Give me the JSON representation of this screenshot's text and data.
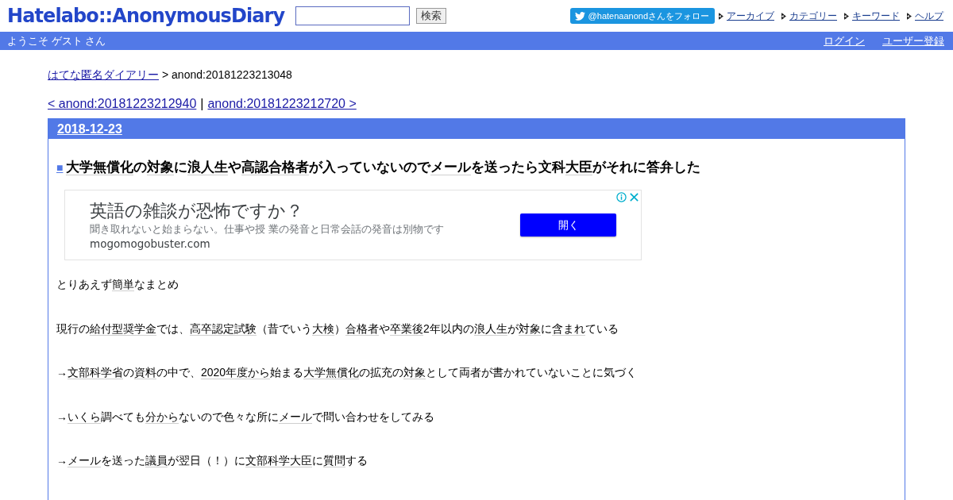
{
  "header": {
    "logo": "Hatelabo::AnonymousDiary",
    "search_button": "検索",
    "follow_button": "@hatenaanondさんをフォロー",
    "nav_links": [
      "アーカイブ",
      "カテゴリー",
      "キーワード",
      "ヘルプ"
    ]
  },
  "user_bar": {
    "greeting": "ようこそ ゲスト さん",
    "links": [
      "ログイン",
      "ユーザー登録"
    ]
  },
  "breadcrumb": {
    "home": "はてな匿名ダイアリー",
    "current": "> anond:20181223213048"
  },
  "pager": {
    "prev": "< anond:20181223212940",
    "separator": "|",
    "next": "anond:20181223212720 >"
  },
  "day": {
    "date": "2018-12-23",
    "entry": {
      "marker": "■",
      "title": [
        {
          "text": "大学無償化",
          "kind": "keyword"
        },
        {
          "text": "の",
          "kind": "text"
        },
        {
          "text": "対象",
          "kind": "keyword"
        },
        {
          "text": "に",
          "kind": "text"
        },
        {
          "text": "浪人生",
          "kind": "keyword"
        },
        {
          "text": "や",
          "kind": "text"
        },
        {
          "text": "高認合格者",
          "kind": "keyword"
        },
        {
          "text": "が入っていないので",
          "kind": "text"
        },
        {
          "text": "メール",
          "kind": "keyword"
        },
        {
          "text": "を送ったら文科",
          "kind": "text"
        },
        {
          "text": "大臣",
          "kind": "keyword"
        },
        {
          "text": "がそれに答弁した",
          "kind": "text"
        }
      ],
      "ad": {
        "headline": "英語の雑談が恐怖ですか？",
        "description": "聞き取れないと始まらない。仕事や授 業の発音と日常会話の発音は別物です",
        "domain": "mogomogobuster.com",
        "button": "開く"
      },
      "paragraphs": [
        [
          {
            "text": "とりあえず",
            "kind": "text"
          },
          {
            "text": "簡単",
            "kind": "keyword"
          },
          {
            "text": "なまとめ",
            "kind": "text"
          }
        ],
        [
          {
            "text": "現行の",
            "kind": "text"
          },
          {
            "text": "給付型奨学金",
            "kind": "keyword"
          },
          {
            "text": "では、",
            "kind": "text"
          },
          {
            "text": "高卒認定試験",
            "kind": "keyword"
          },
          {
            "text": "（昔でいう",
            "kind": "text"
          },
          {
            "text": "大検",
            "kind": "keyword"
          },
          {
            "text": "）",
            "kind": "text"
          },
          {
            "text": "合格者",
            "kind": "keyword"
          },
          {
            "text": "や",
            "kind": "text"
          },
          {
            "text": "卒業後",
            "kind": "keyword"
          },
          {
            "text": "2年以内の",
            "kind": "text"
          },
          {
            "text": "浪人生",
            "kind": "keyword"
          },
          {
            "text": "が",
            "kind": "text"
          },
          {
            "text": "対象",
            "kind": "keyword"
          },
          {
            "text": "に",
            "kind": "text"
          },
          {
            "text": "含まれ",
            "kind": "keyword"
          },
          {
            "text": "ている",
            "kind": "text"
          }
        ],
        [
          {
            "text": "→",
            "kind": "text"
          },
          {
            "text": "文部科学省",
            "kind": "keyword"
          },
          {
            "text": "の",
            "kind": "text"
          },
          {
            "text": "資料",
            "kind": "keyword"
          },
          {
            "text": "の中で、",
            "kind": "text"
          },
          {
            "text": "2020年度から",
            "kind": "keyword"
          },
          {
            "text": "始まる",
            "kind": "text"
          },
          {
            "text": "大学無償化",
            "kind": "keyword"
          },
          {
            "text": "の拡充の",
            "kind": "text"
          },
          {
            "text": "対象",
            "kind": "keyword"
          },
          {
            "text": "として両者が書かれていないことに気づく",
            "kind": "text"
          }
        ],
        [
          {
            "text": "→",
            "kind": "text"
          },
          {
            "text": "いくら",
            "kind": "keyword"
          },
          {
            "text": "調べても",
            "kind": "text"
          },
          {
            "text": "分から",
            "kind": "keyword"
          },
          {
            "text": "ないので色々な所に",
            "kind": "text"
          },
          {
            "text": "メール",
            "kind": "keyword"
          },
          {
            "text": "で問い合わせをしてみる",
            "kind": "text"
          }
        ],
        [
          {
            "text": "→",
            "kind": "text"
          },
          {
            "text": "メール",
            "kind": "keyword"
          },
          {
            "text": "を送った",
            "kind": "text"
          },
          {
            "text": "議員",
            "kind": "keyword"
          },
          {
            "text": "が翌日（！）に",
            "kind": "text"
          },
          {
            "text": "文部科学大臣",
            "kind": "keyword"
          },
          {
            "text": "に",
            "kind": "text"
          },
          {
            "text": "質問",
            "kind": "keyword"
          },
          {
            "text": "する",
            "kind": "text"
          }
        ]
      ]
    }
  }
}
